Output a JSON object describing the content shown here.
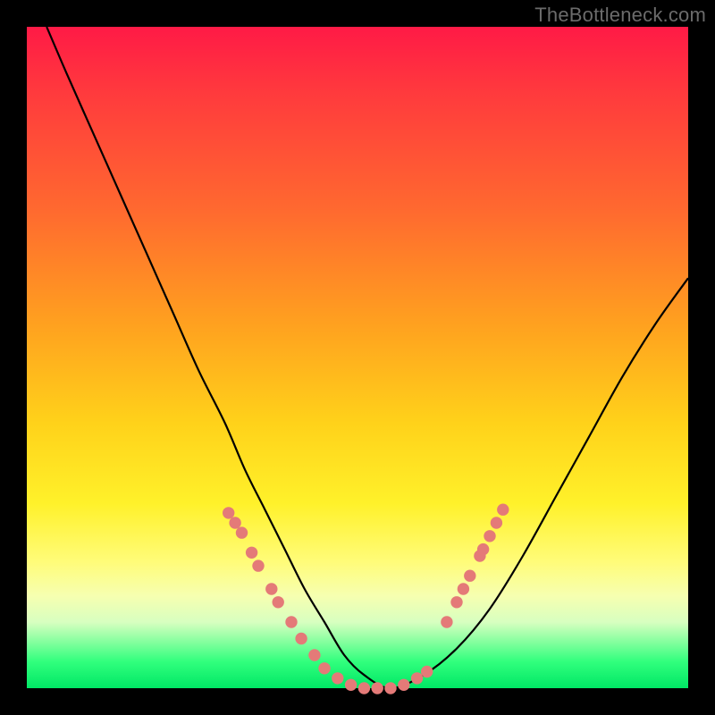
{
  "watermark": "TheBottleneck.com",
  "chart_data": {
    "type": "line",
    "title": "",
    "xlabel": "",
    "ylabel": "",
    "xlim": [
      0,
      100
    ],
    "ylim": [
      0,
      100
    ],
    "grid": false,
    "legend": false,
    "series": [
      {
        "name": "curve",
        "x": [
          3,
          6,
          10,
          14,
          18,
          22,
          26,
          30,
          33,
          36,
          39,
          42,
          45,
          48,
          51,
          55,
          60,
          65,
          70,
          75,
          80,
          85,
          90,
          95,
          100
        ],
        "y": [
          100,
          93,
          84,
          75,
          66,
          57,
          48,
          40,
          33,
          27,
          21,
          15,
          10,
          5,
          2,
          0,
          2,
          6,
          12,
          20,
          29,
          38,
          47,
          55,
          62
        ]
      }
    ],
    "points": [
      {
        "x": 30.5,
        "y": 26.5
      },
      {
        "x": 31.5,
        "y": 25.0
      },
      {
        "x": 32.5,
        "y": 23.5
      },
      {
        "x": 34.0,
        "y": 20.5
      },
      {
        "x": 35.0,
        "y": 18.5
      },
      {
        "x": 37.0,
        "y": 15.0
      },
      {
        "x": 38.0,
        "y": 13.0
      },
      {
        "x": 40.0,
        "y": 10.0
      },
      {
        "x": 41.5,
        "y": 7.5
      },
      {
        "x": 43.5,
        "y": 5.0
      },
      {
        "x": 45.0,
        "y": 3.0
      },
      {
        "x": 47.0,
        "y": 1.5
      },
      {
        "x": 49.0,
        "y": 0.5
      },
      {
        "x": 51.0,
        "y": 0.0
      },
      {
        "x": 53.0,
        "y": 0.0
      },
      {
        "x": 55.0,
        "y": 0.0
      },
      {
        "x": 57.0,
        "y": 0.5
      },
      {
        "x": 59.0,
        "y": 1.5
      },
      {
        "x": 60.5,
        "y": 2.5
      },
      {
        "x": 63.5,
        "y": 10.0
      },
      {
        "x": 65.0,
        "y": 13.0
      },
      {
        "x": 66.0,
        "y": 15.0
      },
      {
        "x": 67.0,
        "y": 17.0
      },
      {
        "x": 68.5,
        "y": 20.0
      },
      {
        "x": 69.0,
        "y": 21.0
      },
      {
        "x": 70.0,
        "y": 23.0
      },
      {
        "x": 71.0,
        "y": 25.0
      },
      {
        "x": 72.0,
        "y": 27.0
      }
    ],
    "point_radius_pct": 0.9
  }
}
